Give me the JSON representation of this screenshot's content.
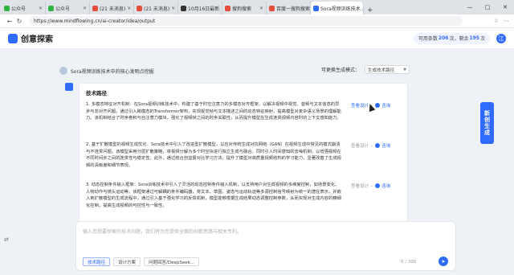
{
  "browser": {
    "tabs": [
      {
        "label": "公众号",
        "color": "#2fb344"
      },
      {
        "label": "公众号",
        "color": "#2fb344"
      },
      {
        "label": "(21 未消息)",
        "color": "#e44d3a"
      },
      {
        "label": "(21 未消息)",
        "color": "#e44d3a"
      },
      {
        "label": "10月16日最新",
        "color": "#333333"
      },
      {
        "label": "搜狗搜索",
        "color": "#e44d3a"
      },
      {
        "label": "百度一搜狗搜索",
        "color": "#e44d3a"
      },
      {
        "label": "Sora视频训练技术...",
        "color": "#2f6bff"
      }
    ],
    "new_tab": "+",
    "url": "https://www.mindflowing.cn/ai-creator/idea/output",
    "window_controls": [
      "—",
      "□",
      "✕"
    ]
  },
  "header": {
    "title": "创意探索",
    "points_prefix": "可用条数",
    "points_value": "206",
    "points_mid": "次，剩余",
    "points_value2": "195",
    "points_suffix": "次",
    "avatar_letter": "江"
  },
  "question": {
    "text": "Sora视频训练技术中的核心发明点挖掘"
  },
  "mode": {
    "label": "可更换生成模式：",
    "selected": "生成技术路径"
  },
  "card": {
    "title": "技术路径",
    "paragraphs": [
      {
        "text": "1. 多模态特征对齐机制：在Sora视频训练技术中，构建了基于时空注意力的多模态对齐框架，以解决视频中视觉、音频与文本信息的异步与非对齐问题。通过引入跨模态的Transformer架构，实现视觉帧与文本描述之间的动态特征映射，提高模型对复杂语义场景的理解能力。该机制结合了时序卷积与自注意力模块，强化了视频帧之间的时序关联性，从而提升模型在生成连贯视频内容时的上下文感知能力。",
        "action1": "查看设计",
        "action2": "咨询"
      },
      {
        "text": "2. 基于扩散模型的视频生成优化：Sora技术中引入了改进型扩散模型，以应对传统生成对抗网络（GAN）在视频生成中常见的模式崩溃与不连贯问题。该模型采用分层扩散策略，将视频分解为多个时空块进行独立生成与融合，同时引入时间感知的去噪机制，以增强视频在不同时间步之间的连贯性与稳定性。此外，通过结合自监督对比学习方法，提升了模型对高质量视频结构的学习能力，显著改善了生成视频的清晰度和细节表现。",
        "action1": "查看设计",
        "action2": "咨询"
      },
      {
        "text": "3. 动态控制条件输入框架：Sora训练技术中引入了灵活的动态控制条件输入机制，以支持用户对生成视频的多维度控制，如场景变化、人物动作与镜头运动等。该框架通过可解耦的条件编码器，将文本、草图、姿态与运动轨迹等多源控制信号映射为统一的潜在表示，并嵌入到扩散模型的生成流程中。通过引入基于强化学习的反馈机制，模型能够根据生成结果动态调整控制参数，从而实现对生成内容的精细化控制，提高生成视频的可控性与一致性。",
        "action1": "查看设计",
        "action2": "咨询"
      }
    ]
  },
  "chat": {
    "placeholder": "输入您想要探索的技术问题，我们将为您提供全面的创新思路与相关专利。",
    "chips": [
      "技术路径",
      "设计方案",
      "问题回答/DeepSeek..."
    ],
    "count": "0 / 300"
  },
  "side_tab": {
    "label": "新创生成"
  },
  "colors": {
    "accent": "#2f6bff",
    "background": "#eef1f6"
  }
}
